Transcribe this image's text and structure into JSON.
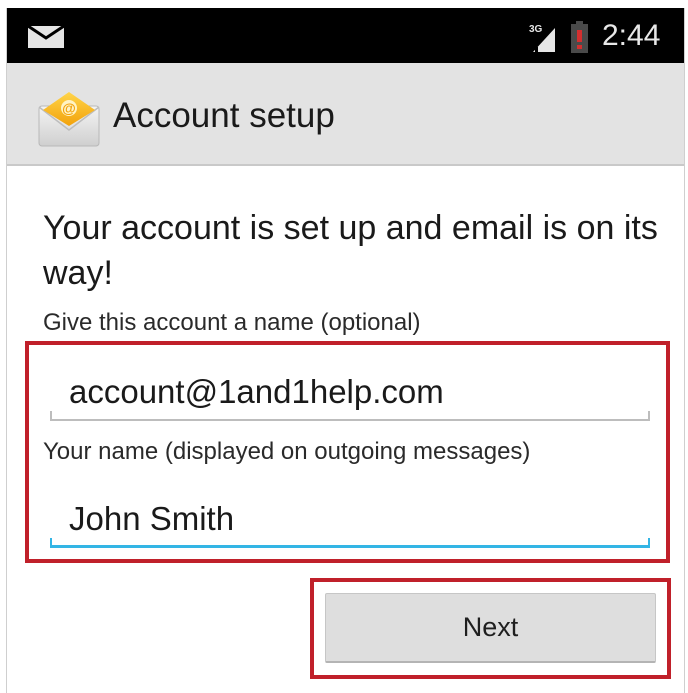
{
  "status_bar": {
    "time": "2:44",
    "network_type": "3G",
    "icons": [
      "email-notification-icon",
      "signal-3g-icon",
      "battery-low-icon"
    ],
    "battery_warning_color": "#d32f2f"
  },
  "action_bar": {
    "title": "Account setup",
    "icon": "email-app-icon"
  },
  "content": {
    "heading": "Your account is set up and email is on its way!",
    "account_name": {
      "label": "Give this account a name (optional)",
      "value": "account@1and1help.com"
    },
    "your_name": {
      "label": "Your name (displayed on outgoing messages)",
      "value": "John Smith",
      "focused": true
    },
    "next_button_label": "Next"
  },
  "colors": {
    "focus_accent": "#33b5e5",
    "highlight_annotation": "#c0202a",
    "action_bar_bg": "#e3e3e3"
  }
}
